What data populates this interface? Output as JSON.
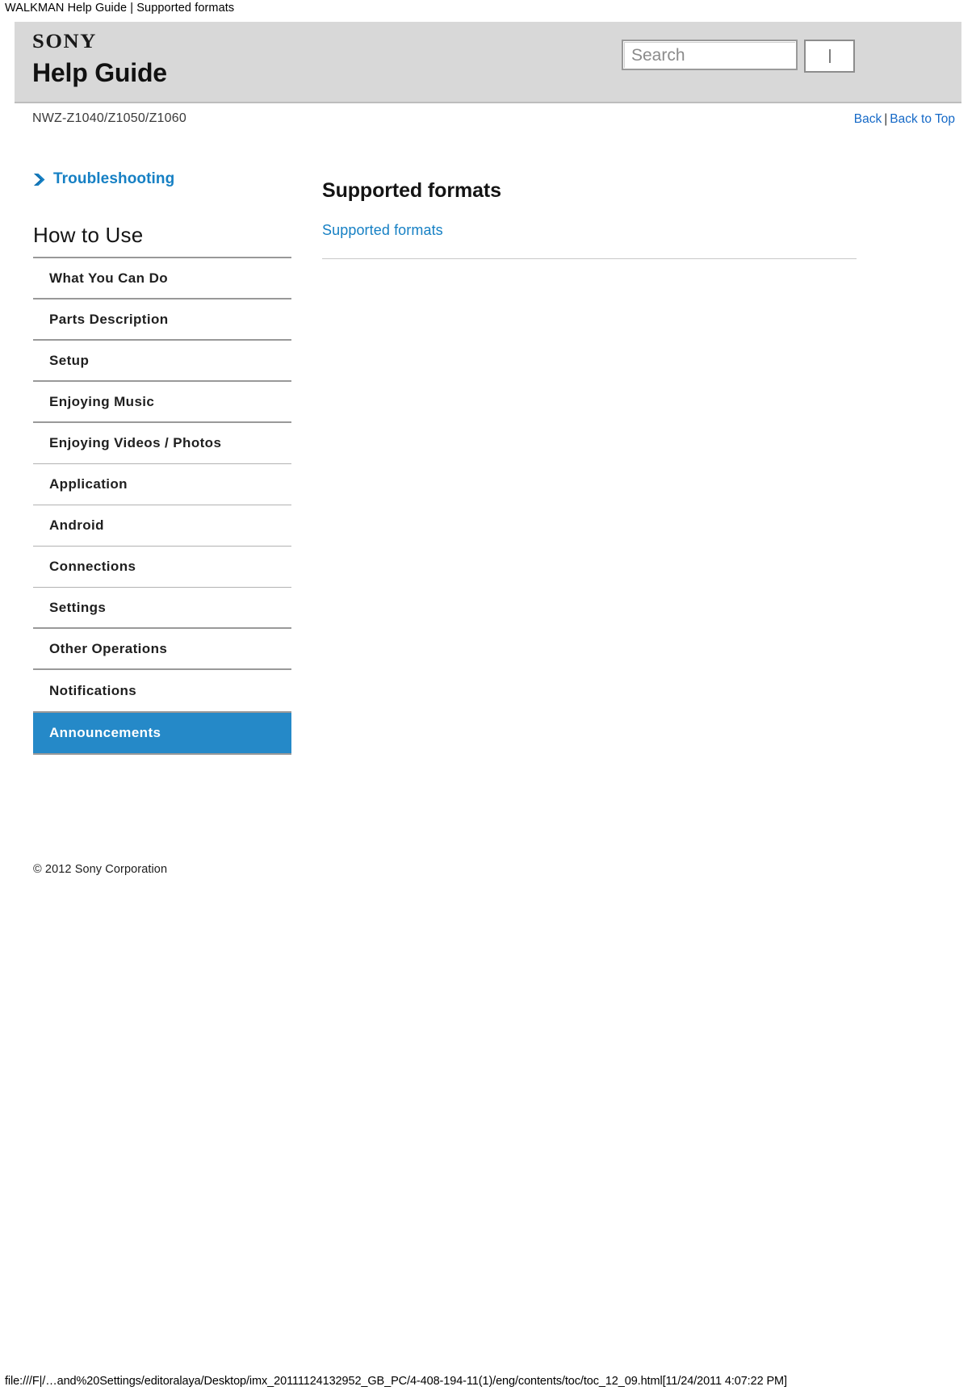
{
  "browser": {
    "page_title": "WALKMAN Help Guide | Supported formats",
    "status_path": "file:///F|/…and%20Settings/editoralaya/Desktop/imx_20111124132952_GB_PC/4-408-194-11(1)/eng/contents/toc/toc_12_09.html[11/24/2011 4:07:22 PM]"
  },
  "banner": {
    "brand": "SONY",
    "title": "Help Guide"
  },
  "search": {
    "placeholder": "Search",
    "value": "",
    "button_label": ""
  },
  "model_bar": {
    "model": "NWZ-Z1040/Z1050/Z1060",
    "back_label": "Back",
    "separator": "|",
    "back_to_top_label": "Back to Top"
  },
  "sidebar": {
    "troubleshooting_label": "Troubleshooting",
    "section_heading": "How to Use",
    "items": [
      {
        "label": "What You Can Do",
        "selected": false
      },
      {
        "label": "Parts Description",
        "selected": false
      },
      {
        "label": "Setup",
        "selected": false
      },
      {
        "label": "Enjoying Music",
        "selected": false
      },
      {
        "label": "Enjoying Videos / Photos",
        "selected": false
      },
      {
        "label": "Application",
        "selected": false
      },
      {
        "label": "Android",
        "selected": false
      },
      {
        "label": "Connections",
        "selected": false
      },
      {
        "label": "Settings",
        "selected": false
      },
      {
        "label": "Other Operations",
        "selected": false
      },
      {
        "label": "Notifications",
        "selected": false
      },
      {
        "label": "Announcements",
        "selected": true
      }
    ],
    "copyright": "© 2012 Sony Corporation"
  },
  "content": {
    "title": "Supported formats",
    "links": [
      {
        "label": "Supported formats"
      }
    ]
  },
  "colors": {
    "accent_blue": "#1680c4",
    "selected_blue": "#2589c8",
    "banner_grey": "#d8d8d8",
    "rule_grey": "#999999"
  }
}
